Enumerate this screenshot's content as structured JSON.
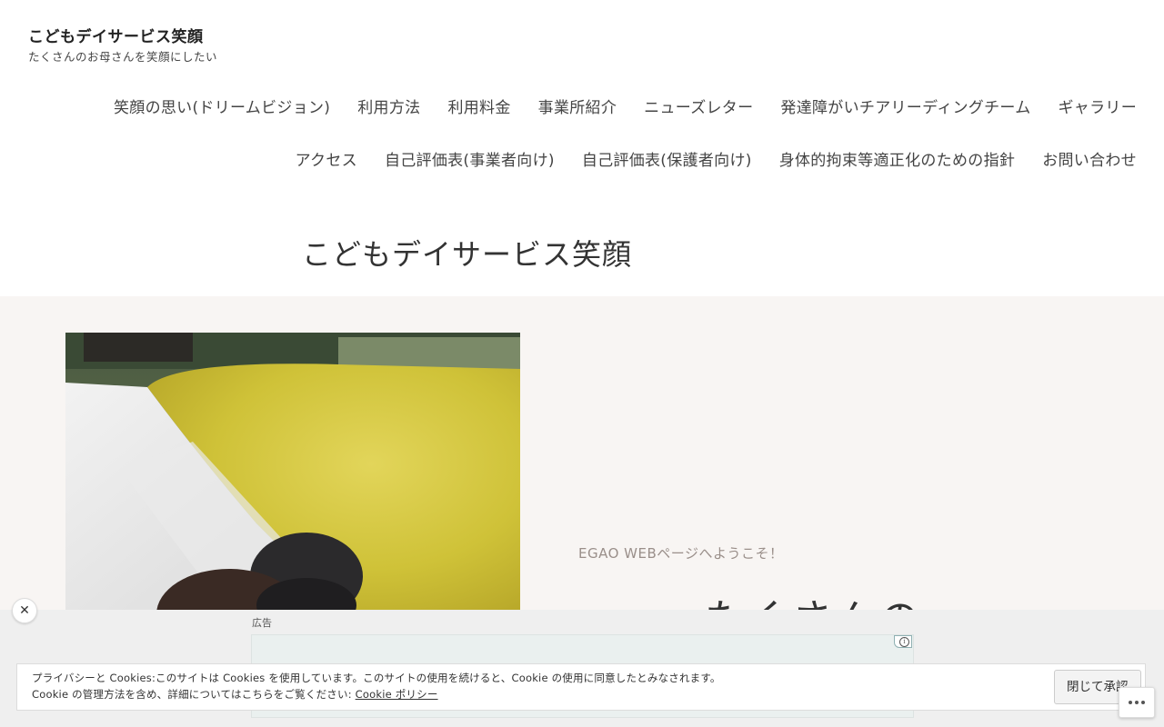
{
  "site": {
    "title": "こどもデイサービス笑顔",
    "tagline": "たくさんのお母さんを笑顔にしたい"
  },
  "nav": {
    "row1": [
      "笑顔の思い(ドリームビジョン)",
      "利用方法",
      "利用料金",
      "事業所紹介",
      "ニューズレター",
      "発達障がいチアリーディングチーム",
      "ギャラリー"
    ],
    "row2": [
      "アクセス",
      "自己評価表(事業者向け)",
      "自己評価表(保護者向け)",
      "身体的拘束等適正化のための指針",
      "お問い合わせ"
    ]
  },
  "page": {
    "title": "こどもデイサービス笑顔"
  },
  "hero": {
    "eyebrow": "EGAO WEBページへようこそ！",
    "headline": "たくさんの"
  },
  "ad": {
    "label": "広告",
    "close_icon": "close-icon",
    "adchoices_icon": "info-icon"
  },
  "cookie": {
    "line1": "プライバシーと Cookies:このサイトは Cookies を使用しています。このサイトの使用を続けると、Cookie の使用に同意したとみなされます。",
    "line2_prefix": "Cookie の管理方法を含め、詳細についてはこちらをご覧ください: ",
    "policy_link": "Cookie ポリシー",
    "accept_label": "閉じて承認"
  },
  "more_icon": "ellipsis-icon",
  "colors": {
    "hero_bg": "#f8f5f3",
    "ad_band": "#efefef",
    "ad_box": "#eaf0ef"
  }
}
